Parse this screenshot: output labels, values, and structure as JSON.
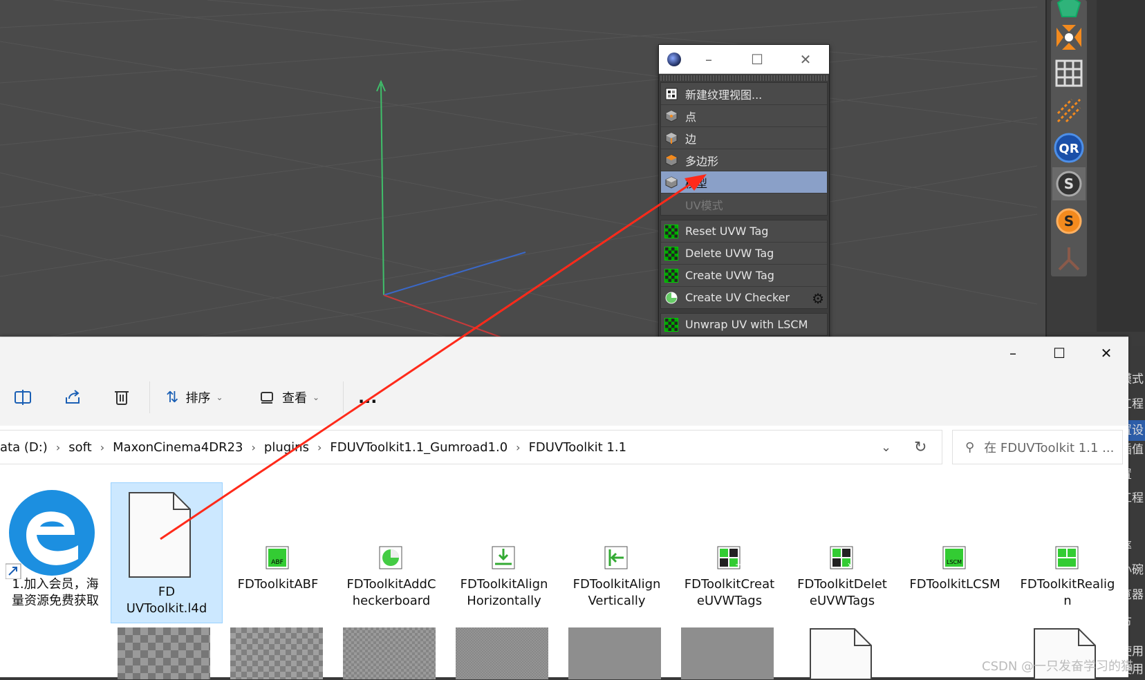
{
  "c4d_menu": {
    "group1": [
      {
        "label": "新建纹理视图...",
        "icon": "texture-view-icon"
      },
      {
        "label": "点",
        "icon": "points-cube-icon"
      },
      {
        "label": "边",
        "icon": "edges-cube-icon"
      },
      {
        "label": "多边形",
        "icon": "polygon-cube-icon"
      },
      {
        "label": "模型",
        "icon": "model-cube-icon",
        "selected": true
      },
      {
        "label": "UV模式",
        "icon": "uv-mode-icon",
        "disabled": true
      }
    ],
    "group2": [
      {
        "label": "Reset UVW Tag",
        "icon": "green-checker-icon"
      },
      {
        "label": "Delete UVW Tag",
        "icon": "green-checker-icon"
      },
      {
        "label": "Create UVW Tag",
        "icon": "green-checker-icon"
      },
      {
        "label": "Create UV Checker",
        "icon": "green-sphere-icon",
        "gear": "gear-icon"
      }
    ],
    "group3": [
      {
        "label": "Unwrap UV with LSCM",
        "icon": "lscm-icon"
      }
    ]
  },
  "side_panel_text": [
    "模式",
    "工程",
    "置设",
    "插值",
    "置",
    "工程",
    "",
    "率",
    "小碗",
    "览器",
    "节",
    "使用",
    "使用"
  ],
  "explorer": {
    "toolbar": {
      "sort_label": "排序",
      "view_label": "查看",
      "more_label": "..."
    },
    "breadcrumb": [
      "ata (D:)",
      "soft",
      "MaxonCinema4DR23",
      "plugins",
      "FDUVToolkit1.1_Gumroad1.0",
      "FDUVToolkit 1.1"
    ],
    "search_placeholder": "在 FDUVToolkit 1.1 ...",
    "files": [
      {
        "name": "1.加入会员，海\n量资源免费获取",
        "icon": "edge-browser-shortcut-icon"
      },
      {
        "name": "FD\nUVToolkit.l4d",
        "icon": "blank-file-icon",
        "selected": true
      },
      {
        "name": "FDToolkitABF",
        "icon": "abf-icon"
      },
      {
        "name": "FDToolkitAddC\nheckerboard",
        "icon": "checkerboard-sphere-icon"
      },
      {
        "name": "FDToolkitAlign\nHorizontally",
        "icon": "align-horizontal-icon"
      },
      {
        "name": "FDToolkitAlign\nVertically",
        "icon": "align-vertical-icon"
      },
      {
        "name": "FDToolkitCreat\neUVWTags",
        "icon": "create-uvw-icon"
      },
      {
        "name": "FDToolkitDelet\neUVWTags",
        "icon": "delete-uvw-icon"
      },
      {
        "name": "FDToolkitLCSM",
        "icon": "lscm-icon"
      },
      {
        "name": "FDToolkitRealig\nn",
        "icon": "realign-icon"
      }
    ]
  },
  "watermark": "CSDN @一只发奋学习的猫",
  "colors": {
    "viewport_bg": "#4a4a4a",
    "menu_selected": "#8aa0c8",
    "explorer_selected": "#cce8ff",
    "arrow": "#ff2a1a"
  }
}
